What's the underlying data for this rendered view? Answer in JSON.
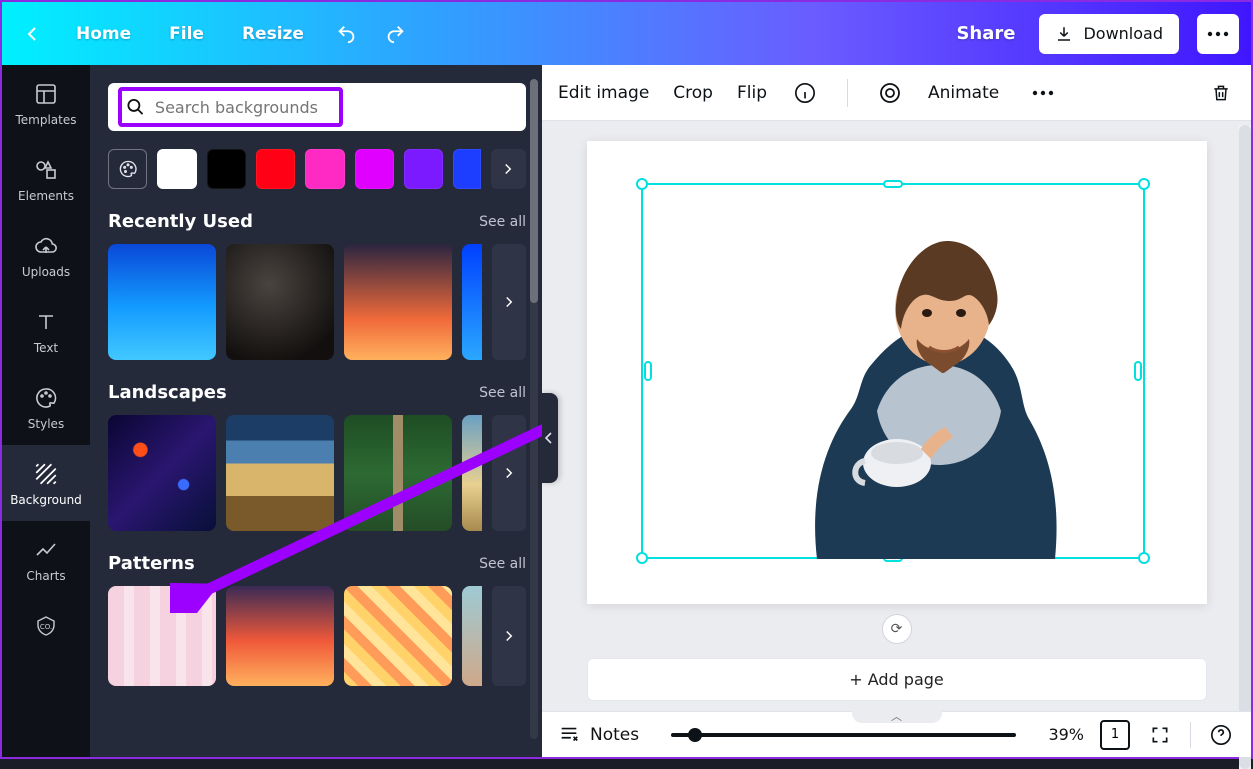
{
  "topbar": {
    "home": "Home",
    "file": "File",
    "resize": "Resize",
    "share": "Share",
    "download": "Download"
  },
  "vtabs": [
    {
      "key": "templates",
      "label": "Templates"
    },
    {
      "key": "elements",
      "label": "Elements"
    },
    {
      "key": "uploads",
      "label": "Uploads"
    },
    {
      "key": "text",
      "label": "Text"
    },
    {
      "key": "styles",
      "label": "Styles"
    },
    {
      "key": "background",
      "label": "Background"
    },
    {
      "key": "charts",
      "label": "Charts"
    },
    {
      "key": "more",
      "label": ""
    }
  ],
  "panel": {
    "search_placeholder": "Search backgrounds",
    "swatches": [
      "#ffffff",
      "#000000",
      "#ff0014",
      "#ff2ac4",
      "#e000ff",
      "#7b1aff",
      "#1d3dff"
    ],
    "sections": {
      "recent": {
        "title": "Recently Used",
        "see_all": "See all"
      },
      "landscapes": {
        "title": "Landscapes",
        "see_all": "See all"
      },
      "patterns": {
        "title": "Patterns",
        "see_all": "See all"
      }
    }
  },
  "canvas_tools": {
    "edit_image": "Edit image",
    "crop": "Crop",
    "flip": "Flip",
    "animate": "Animate"
  },
  "canvas": {
    "add_page": "+ Add page"
  },
  "footer": {
    "notes": "Notes",
    "zoom": "39%",
    "page_indicator": "1"
  }
}
